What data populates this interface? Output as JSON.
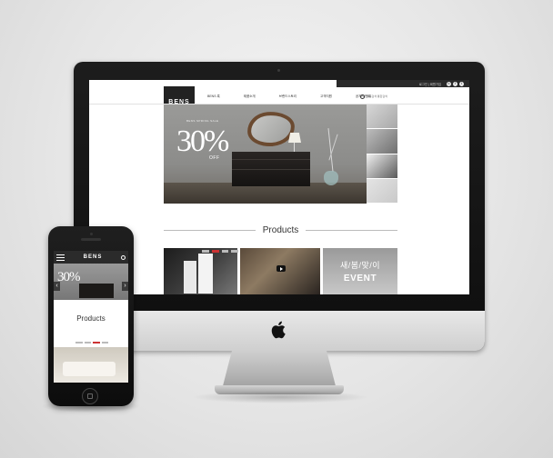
{
  "desktop": {
    "topbar": {
      "links": "로그인 | 회원가입",
      "social": [
        "b",
        "f",
        "t"
      ]
    },
    "logo": "BENS",
    "nav": [
      "BENS 룩",
      "제품소개",
      "브랜드스토리",
      "고객지원",
      "공지/이벤트"
    ],
    "search": {
      "placeholder": "제품검색 통합검색"
    },
    "hero": {
      "small_text": "BENS SPRING SALE",
      "discount": "30%",
      "off": "OFF"
    },
    "products": {
      "title": "Products",
      "event_line1": "새/봄/맞/이",
      "event_line2": "EVENT"
    }
  },
  "mobile": {
    "logo": "BENS",
    "hero_discount": "30%",
    "prev": "‹",
    "next": "›",
    "products_title": "Products"
  },
  "colors": {
    "dark": "#2a2a2a",
    "accent": "#cc3333"
  }
}
